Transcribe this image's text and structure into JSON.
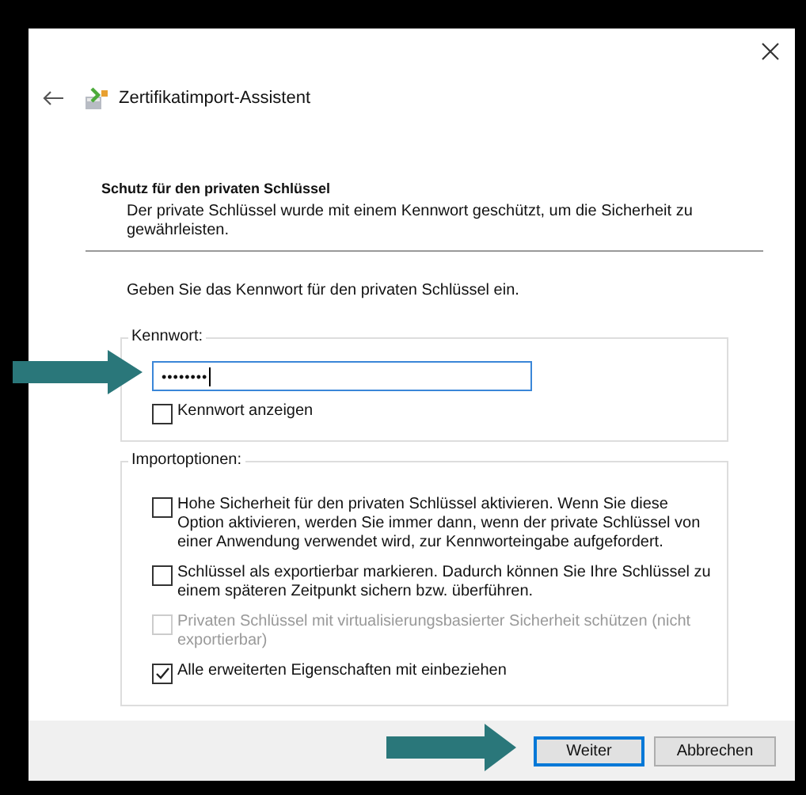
{
  "window": {
    "title": "Zertifikatimport-Assistent"
  },
  "page": {
    "heading": "Schutz für den privaten Schlüssel",
    "description": "Der private Schlüssel wurde mit einem Kennwort geschützt, um die Sicherheit zu gewährleisten.",
    "instruction": "Geben Sie das Kennwort für den privaten Schlüssel ein."
  },
  "password": {
    "legend": "Kennwort:",
    "value": "••••••••",
    "focused": true
  },
  "show_password": {
    "label": "Kennwort anzeigen",
    "checked": false
  },
  "import_options": {
    "legend": "Importoptionen:",
    "options": [
      {
        "label": "Hohe Sicherheit für den privaten Schlüssel aktivieren. Wenn Sie diese Option aktivieren, werden Sie immer dann, wenn der private Schlüssel von einer Anwendung verwendet wird, zur Kennworteingabe aufgefordert.",
        "checked": false,
        "disabled": false
      },
      {
        "label": "Schlüssel als exportierbar markieren. Dadurch können Sie Ihre Schlüssel zu einem späteren Zeitpunkt sichern bzw. überführen.",
        "checked": false,
        "disabled": false
      },
      {
        "label": "Privaten Schlüssel mit virtualisierungsbasierter Sicherheit schützen (nicht exportierbar)",
        "checked": false,
        "disabled": true
      },
      {
        "label": "Alle erweiterten Eigenschaften mit einbeziehen",
        "checked": true,
        "disabled": false
      }
    ]
  },
  "buttons": [
    {
      "label": "Weiter",
      "default": true
    },
    {
      "label": "Abbrechen",
      "default": false
    }
  ]
}
